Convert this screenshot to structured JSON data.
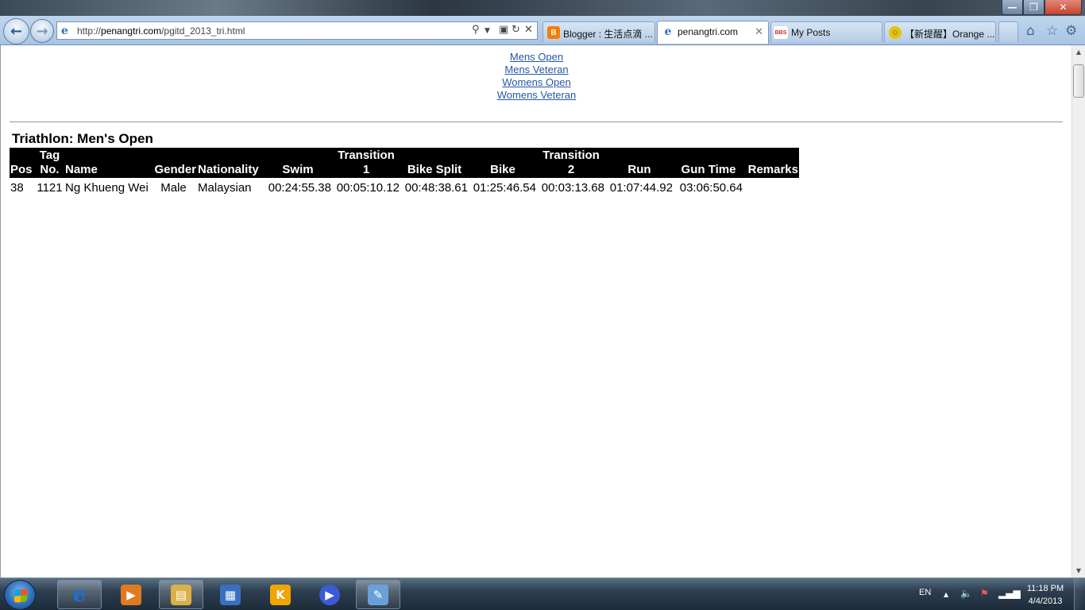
{
  "browser": {
    "address": {
      "prefix": "http://",
      "domain": "penangtri.com",
      "path": "/pgitd_2013_tri.html"
    },
    "tabs": [
      {
        "label": "Blogger : 生活点滴 ...",
        "icon_char": "B",
        "icon_color": "#f57d00",
        "active": false
      },
      {
        "label": "penangtri.com",
        "icon_char": "e",
        "icon_color": "#2b6fc4",
        "active": true
      },
      {
        "label": "My Posts",
        "icon_char": "BBS",
        "icon_color": "#d22",
        "active": false
      },
      {
        "label": "【新提醒】Orange ...",
        "icon_char": "☺",
        "icon_color": "#e8c400",
        "active": false
      }
    ]
  },
  "page": {
    "links": [
      "Mens Open",
      "Mens Veteran",
      "Womens Open",
      "Womens Veteran"
    ],
    "table_title": "Triathlon: Men's Open",
    "columns": [
      {
        "top": "",
        "bottom": "Pos"
      },
      {
        "top": "Tag",
        "bottom": "No."
      },
      {
        "top": "",
        "bottom": "Name"
      },
      {
        "top": "",
        "bottom": "Gender"
      },
      {
        "top": "",
        "bottom": "Nationality"
      },
      {
        "top": "",
        "bottom": "Swim"
      },
      {
        "top": "Transition",
        "bottom": "1"
      },
      {
        "top": "",
        "bottom": "Bike Split"
      },
      {
        "top": "",
        "bottom": "Bike"
      },
      {
        "top": "Transition",
        "bottom": "2"
      },
      {
        "top": "",
        "bottom": "Run"
      },
      {
        "top": "",
        "bottom": "Gun Time"
      },
      {
        "top": "",
        "bottom": "Remarks"
      }
    ],
    "rows": [
      [
        "38",
        "1121",
        "Ng Khueng Wei",
        "Male",
        "Malaysian",
        "00:24:55.38",
        "00:05:10.12",
        "00:48:38.61",
        "01:25:46.54",
        "00:03:13.68",
        "01:07:44.92",
        "03:06:50.64",
        ""
      ]
    ]
  },
  "taskbar": {
    "items": [
      {
        "name": "internet-explorer",
        "glyph": "e",
        "color": "#1f6fd1",
        "running": true
      },
      {
        "name": "media-player",
        "glyph": "▶",
        "color": "#e07a1f",
        "running": false
      },
      {
        "name": "file-explorer",
        "glyph": "▤",
        "color": "#d8b14a",
        "running": true
      },
      {
        "name": "movie-maker",
        "glyph": "▦",
        "color": "#3a6fc0",
        "running": false
      },
      {
        "name": "kingsoft",
        "glyph": "K",
        "color": "#f0a500",
        "running": false
      },
      {
        "name": "video-player",
        "glyph": "▶",
        "color": "#3b5bd6",
        "running": false
      },
      {
        "name": "paint",
        "glyph": "✎",
        "color": "#6aa0d8",
        "running": true
      }
    ],
    "language": "EN",
    "time": "11:18 PM",
    "date": "4/4/2013"
  }
}
